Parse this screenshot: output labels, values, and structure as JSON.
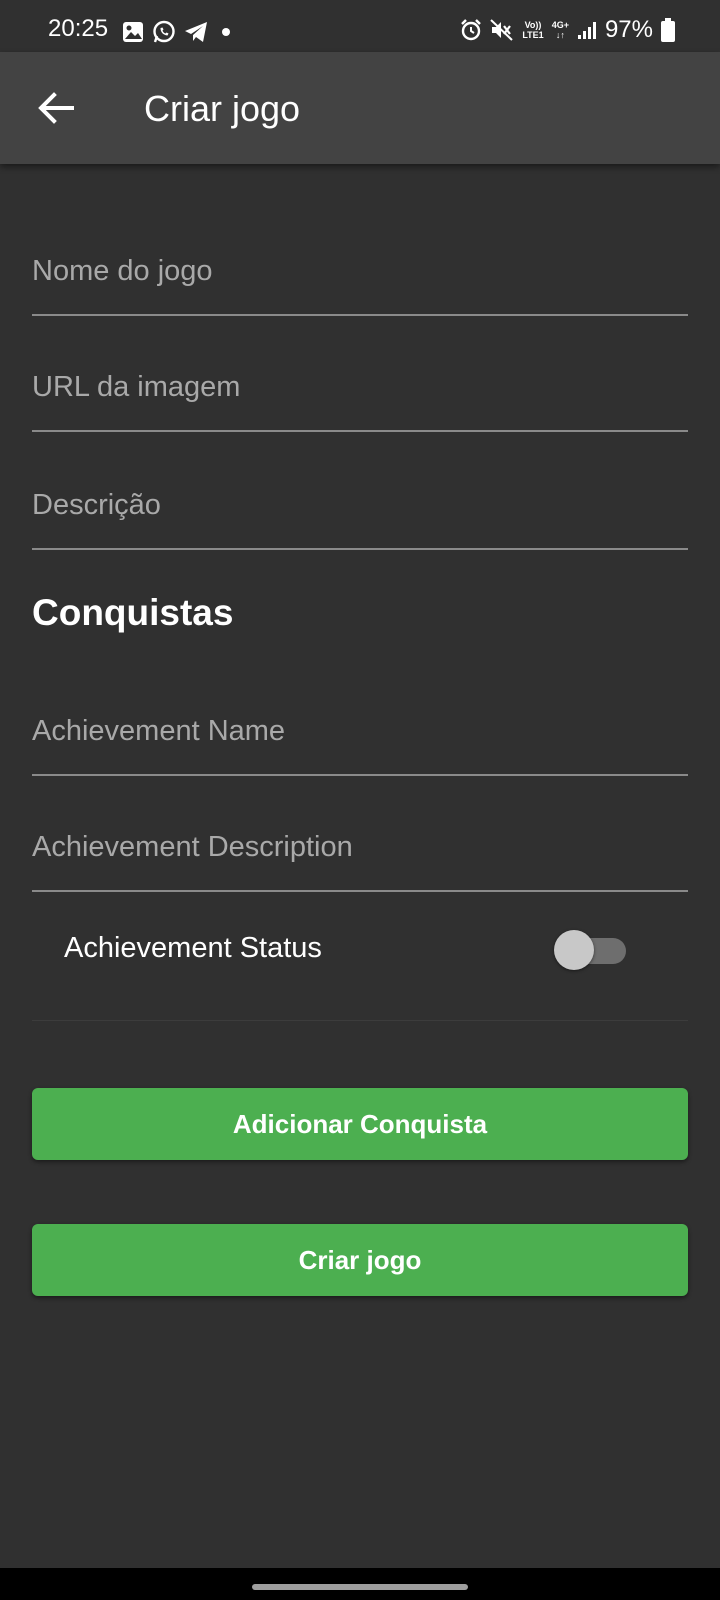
{
  "status_bar": {
    "time": "20:25",
    "left_icons": [
      "gallery-icon",
      "whatsapp-icon",
      "telegram-icon",
      "dot-icon"
    ],
    "right_icons": [
      "alarm-icon",
      "mute-icon",
      "volte-icon",
      "network-4g-icon",
      "signal-icon",
      "battery-icon"
    ],
    "volte_top": "Vo))",
    "volte_bottom": "LTE1",
    "network_label": "4G+",
    "battery": "97%"
  },
  "app_bar": {
    "title": "Criar jogo",
    "back_icon": "arrow-back-icon"
  },
  "form": {
    "name_placeholder": "Nome do jogo",
    "name_value": "",
    "image_url_placeholder": "URL da imagem",
    "image_url_value": "",
    "description_placeholder": "Descrição",
    "description_value": ""
  },
  "achievements": {
    "section_title": "Conquistas",
    "name_placeholder": "Achievement Name",
    "name_value": "",
    "description_placeholder": "Achievement Description",
    "description_value": "",
    "status_label": "Achievement Status",
    "status_on": false
  },
  "buttons": {
    "add_achievement": "Adicionar Conquista",
    "create_game": "Criar jogo"
  },
  "colors": {
    "background": "#303030",
    "app_bar": "#434343",
    "accent_green": "#4caf50"
  }
}
